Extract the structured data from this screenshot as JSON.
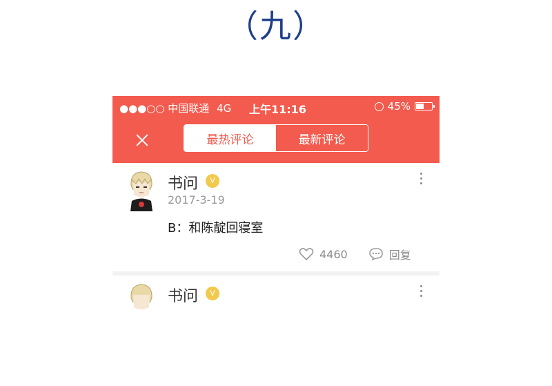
{
  "heading": "（九）",
  "status_bar": {
    "signal": "●●●○○",
    "carrier": "中国联通",
    "network": "4G",
    "time": "上午11:16",
    "battery_text": "45%",
    "battery_level": 0.45
  },
  "navbar": {
    "tabs": [
      {
        "label": "最热评论",
        "active": true
      },
      {
        "label": "最新评论",
        "active": false
      }
    ]
  },
  "comments": [
    {
      "username": "书问",
      "badge": "V",
      "date": "2017-3-19",
      "text": "B：和陈靛回寝室",
      "likes": "4460",
      "reply_label": "回复"
    },
    {
      "username": "书问",
      "badge": "V"
    }
  ],
  "icons": {
    "close": "close-icon",
    "alarm": "alarm-icon",
    "battery": "battery-icon",
    "badge": "vip-badge-icon",
    "more": "more-icon",
    "like": "heart-icon",
    "reply": "comment-bubble-icon"
  },
  "colors": {
    "accent": "#f25b4e",
    "heading": "#1f3f8c",
    "badge": "#f2c94c",
    "muted": "#9a9a9a"
  }
}
